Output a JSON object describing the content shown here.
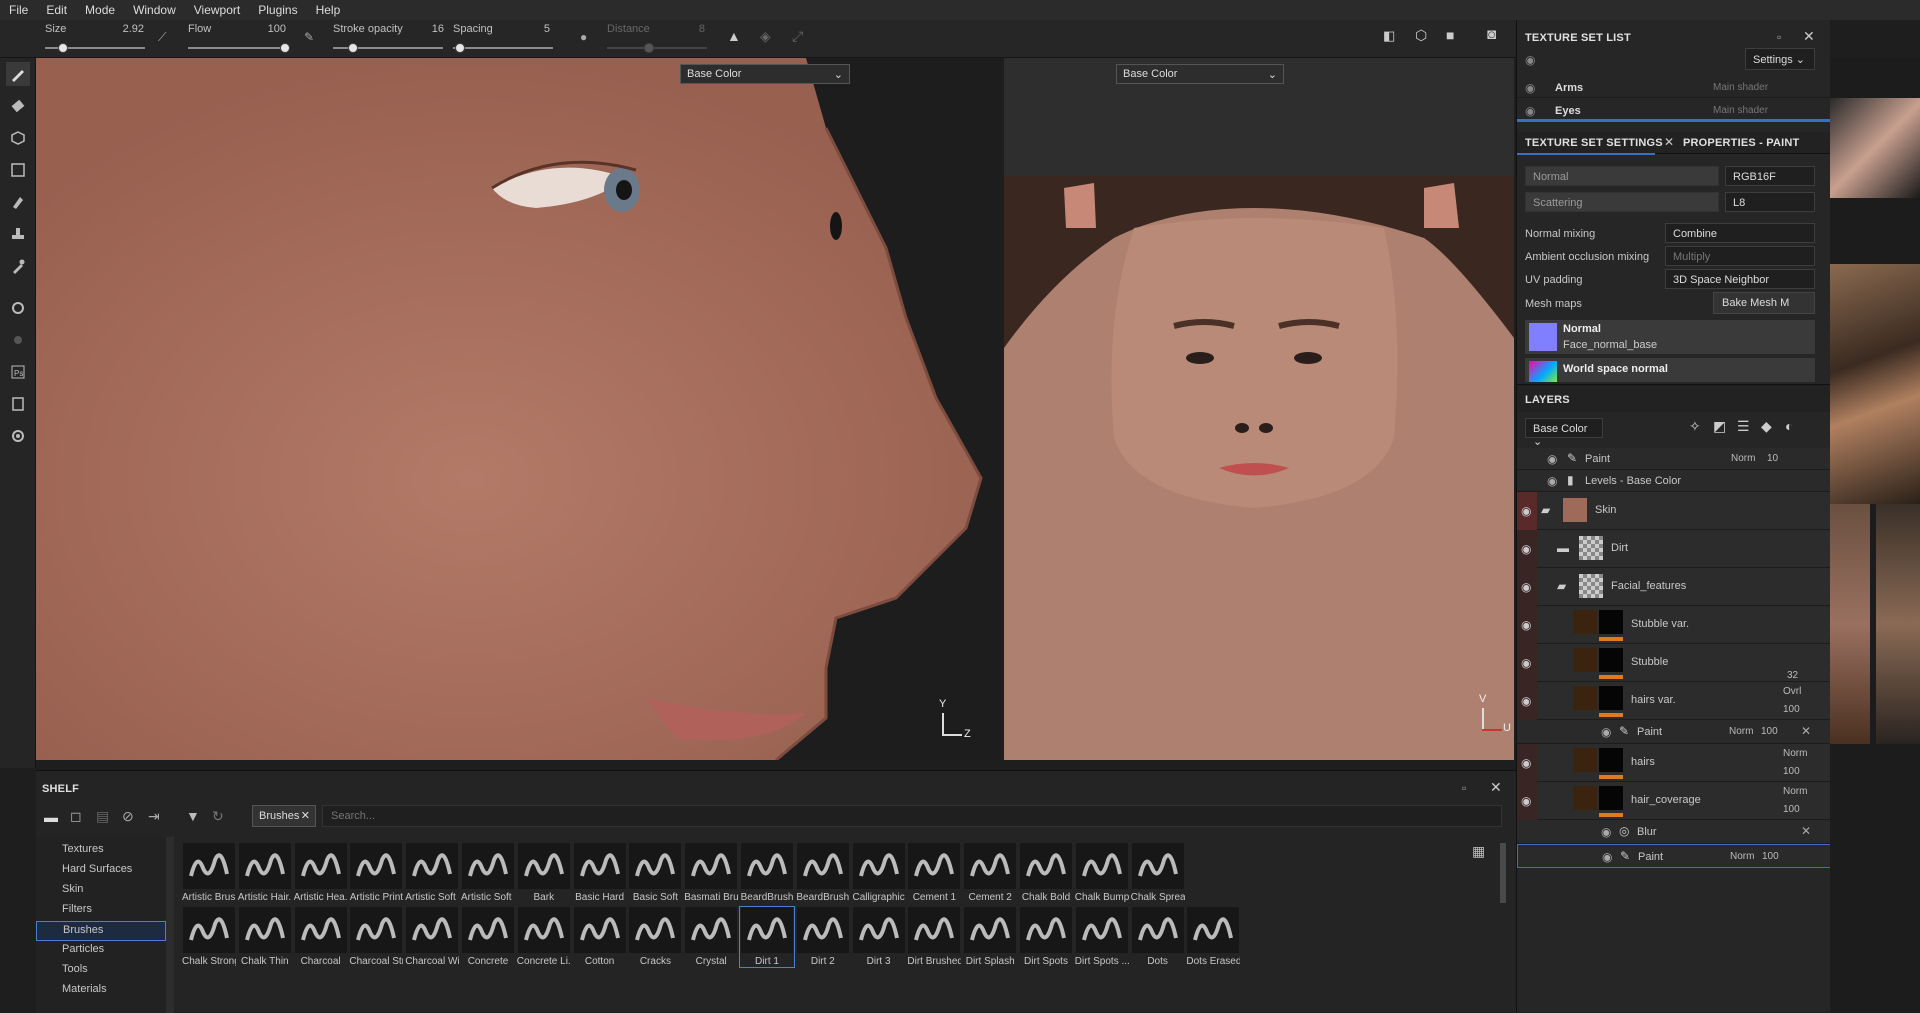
{
  "menu": [
    "File",
    "Edit",
    "Mode",
    "Window",
    "Viewport",
    "Plugins",
    "Help"
  ],
  "toolbar": {
    "size_label": "Size",
    "size_value": "2.92",
    "flow_label": "Flow",
    "flow_value": "100",
    "stroke_opacity_label": "Stroke opacity",
    "stroke_opacity_value": "16",
    "spacing_label": "Spacing",
    "spacing_value": "5",
    "distance_label": "Distance",
    "distance_value": "8"
  },
  "viewport3d": {
    "channel": "Base Color",
    "axis_y": "Y",
    "axis_z": "Z"
  },
  "viewport2d": {
    "channel": "Base Color",
    "axis_v": "V",
    "axis_u": "U"
  },
  "texture_set_list": {
    "title": "TEXTURE SET LIST",
    "settings_label": "Settings",
    "items": [
      {
        "name": "Arms",
        "shader": "Main shader"
      },
      {
        "name": "Eyes",
        "shader": "Main shader"
      }
    ]
  },
  "texture_set_settings": {
    "tab1": "TEXTURE SET SETTINGS",
    "tab2": "PROPERTIES - PAINT",
    "channel1": "Normal",
    "format1": "RGB16F",
    "channel2": "Scattering",
    "format2": "L8",
    "normal_mixing_label": "Normal mixing",
    "normal_mixing_value": "Combine",
    "ao_mixing_label": "Ambient occlusion mixing",
    "ao_mixing_value": "Multiply",
    "uv_padding_label": "UV padding",
    "uv_padding_value": "3D Space Neighbor",
    "mesh_maps_label": "Mesh maps",
    "bake_button": "Bake Mesh M",
    "maps": [
      {
        "name": "Normal",
        "file": "Face_normal_base"
      },
      {
        "name": "World space normal",
        "file": ""
      }
    ]
  },
  "layers": {
    "title": "LAYERS",
    "channel": "Base Color",
    "sub_paint": {
      "name": "Paint",
      "blend": "Norm",
      "opacity": "10"
    },
    "sub_levels": {
      "name": "Levels - Base Color"
    },
    "skin": "Skin",
    "dirt": "Dirt",
    "facial": "Facial_features",
    "stubble_var": "Stubble var.",
    "stubble": "Stubble",
    "stubble_val": "32",
    "hairs_var": {
      "name": "hairs var.",
      "blend": "Ovrl",
      "opacity": "100"
    },
    "paint2": {
      "name": "Paint",
      "blend": "Norm",
      "opacity": "100"
    },
    "hairs": {
      "name": "hairs",
      "blend": "Norm",
      "opacity": "100"
    },
    "hair_coverage": {
      "name": "hair_coverage",
      "blend": "Norm",
      "opacity": "100"
    },
    "blur": "Blur",
    "paint3": "Paint",
    "paint3_blend": "Norm",
    "paint3_opacity": "100"
  },
  "shelf": {
    "title": "SHELF",
    "filter_tag": "Brushes",
    "search_placeholder": "Search...",
    "categories": [
      "Textures",
      "Hard Surfaces",
      "Skin",
      "Filters",
      "Brushes",
      "Particles",
      "Tools",
      "Materials"
    ],
    "selected_category": "Brushes",
    "row1": [
      "Artistic Brus...",
      "Artistic Hair...",
      "Artistic Hea...",
      "Artistic Print",
      "Artistic Soft ...",
      "Artistic Soft ...",
      "Bark",
      "Basic Hard",
      "Basic Soft",
      "Basmati Bru...",
      "BeardBrush",
      "BeardBrush",
      "Calligraphic",
      "Cement 1",
      "Cement 2",
      "Chalk Bold",
      "Chalk Bumpy",
      "Chalk Spread"
    ],
    "row2": [
      "Chalk Strong",
      "Chalk Thin",
      "Charcoal",
      "Charcoal Str...",
      "Charcoal Wi...",
      "Concrete",
      "Concrete Li...",
      "Cotton",
      "Cracks",
      "Crystal",
      "Dirt 1",
      "Dirt 2",
      "Dirt 3",
      "Dirt Brushed",
      "Dirt Splash",
      "Dirt Spots",
      "Dirt Spots ...",
      "Dots",
      "Dots Erased"
    ],
    "selected_brush": "Dirt 1"
  }
}
